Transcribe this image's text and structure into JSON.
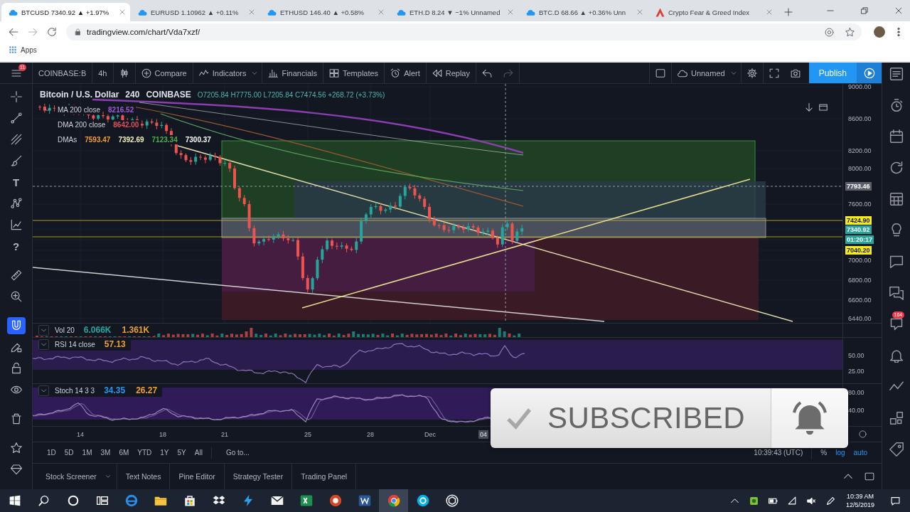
{
  "browser": {
    "tabs": [
      {
        "title": "BTCUSD 7340.92 ▲ +1.97%",
        "selected": true
      },
      {
        "title": "EURUSD 1.10962 ▲ +0.11%",
        "selected": false
      },
      {
        "title": "ETHUSD 146.40 ▲ +0.58%",
        "selected": false
      },
      {
        "title": "ETH.D 8.24 ▼ −1% Unnamed",
        "selected": false
      },
      {
        "title": "BTC.D 68.66 ▲ +0.36% Unn",
        "selected": false
      },
      {
        "title": "Crypto Fear & Greed Index",
        "selected": false
      }
    ],
    "address": "tradingview.com/chart/Vda7xzf/",
    "bookmarks": [
      "Apps"
    ]
  },
  "toolbar": {
    "menu_badge": "11",
    "symbol": "COINBASE:B",
    "interval": "4h",
    "buttons": [
      "Compare",
      "Indicators",
      "Financials",
      "Templates",
      "Alert",
      "Replay"
    ],
    "layout_name": "Unnamed",
    "publish": "Publish"
  },
  "legend": {
    "title": [
      "Bitcoin / U.S. Dollar",
      "240",
      "COINBASE"
    ],
    "values": "O7205.84 H7775.00 L7205.84 C7474.56 +268.72 (+3.73%)",
    "indicators": [
      {
        "name": "MA 200 close",
        "values": [
          {
            "text": "8216.52",
            "color": "#9c5bd6"
          }
        ]
      },
      {
        "name": "DMA 200 close",
        "values": [
          {
            "text": "8642.00",
            "color": "#e0505a"
          }
        ]
      },
      {
        "name": "DMAs",
        "values": [
          {
            "text": "7593.47",
            "color": "#f0a030"
          },
          {
            "text": "7392.69",
            "color": "#f2f0c0"
          },
          {
            "text": "7123.34",
            "color": "#4caf50"
          },
          {
            "text": "7300.37",
            "color": "#ffffff"
          }
        ]
      }
    ]
  },
  "price_axis": [
    {
      "text": "9000.00",
      "kind": "tick"
    },
    {
      "text": "8600.00",
      "kind": "tick"
    },
    {
      "text": "8200.00",
      "kind": "tick"
    },
    {
      "text": "8000.00",
      "kind": "tick"
    },
    {
      "text": "7793.46",
      "kind": "marker",
      "color": "#5d606b"
    },
    {
      "text": "7600.00",
      "kind": "tick"
    },
    {
      "text": "7424.90",
      "kind": "marker",
      "color": "#f5eb1a"
    },
    {
      "text": "7340.92",
      "kind": "marker",
      "color": "#26a69a"
    },
    {
      "text": "01:20:17",
      "kind": "marker",
      "color": "#26a69a"
    },
    {
      "text": "7040.20",
      "kind": "marker",
      "color": "#f5eb1a"
    },
    {
      "text": "7000.00",
      "kind": "tick"
    },
    {
      "text": "6800.00",
      "kind": "tick"
    },
    {
      "text": "6600.00",
      "kind": "tick"
    },
    {
      "text": "6440.00",
      "kind": "tick"
    }
  ],
  "panes": [
    {
      "kind": "volume",
      "name": "Vol 20",
      "values": [
        {
          "text": "6.066K",
          "color": "#26a69a"
        },
        {
          "text": "1.361K",
          "color": "#f0a030"
        }
      ]
    },
    {
      "kind": "rsi",
      "name": "RSI 14 close",
      "values": [
        {
          "text": "57.13",
          "color": "#f0a030"
        }
      ],
      "axis": [
        "50.00",
        "25.00"
      ]
    },
    {
      "kind": "stoch",
      "name": "Stoch 14 3 3",
      "values": [
        {
          "text": "34.35",
          "color": "#2196f3"
        },
        {
          "text": "26.27",
          "color": "#f0a030"
        }
      ],
      "axis": [
        "80.00",
        "40.00"
      ]
    }
  ],
  "time_axis": [
    {
      "text": "14",
      "kind": "tick"
    },
    {
      "text": "18",
      "kind": "tick"
    },
    {
      "text": "21",
      "kind": "tick"
    },
    {
      "text": "25",
      "kind": "tick"
    },
    {
      "text": "28",
      "kind": "tick"
    },
    {
      "text": "Dec",
      "kind": "tick"
    },
    {
      "text": "04",
      "kind": "cursor"
    }
  ],
  "range_bar": {
    "ranges": [
      "1D",
      "5D",
      "1M",
      "3M",
      "6M",
      "YTD",
      "1Y",
      "5Y",
      "All"
    ],
    "goto": "Go to...",
    "clock": "10:39:43 (UTC)",
    "scale_options": [
      {
        "label": "%",
        "selected": false
      },
      {
        "label": "log",
        "selected": true
      },
      {
        "label": "auto",
        "selected": true
      }
    ]
  },
  "drawing_tools": [
    {
      "selected": false
    },
    {
      "selected": false
    },
    {
      "selected": false
    },
    {
      "selected": false
    },
    {
      "glyph": "T",
      "selected": false
    },
    {
      "selected": false
    },
    {
      "selected": false
    },
    {
      "glyph": "?",
      "selected": false
    },
    {
      "selected": false
    },
    {
      "selected": false
    },
    {
      "selected": true
    },
    {
      "selected": false
    },
    {
      "selected": false
    },
    {
      "selected": false
    },
    {
      "selected": false
    },
    {
      "selected": false
    },
    {
      "selected": false
    }
  ],
  "side_panel": {
    "badge": "164"
  },
  "bottom_tabs": [
    "Stock Screener",
    "Text Notes",
    "Pine Editor",
    "Strategy Tester",
    "Trading Panel"
  ],
  "taskbar": {
    "apps": [
      {
        "selected": false
      },
      {
        "selected": false
      },
      {
        "selected": false
      },
      {
        "selected": false
      },
      {
        "selected": false
      },
      {
        "selected": false
      },
      {
        "selected": false
      },
      {
        "selected": false
      },
      {
        "selected": false
      },
      {
        "selected": true
      },
      {
        "selected": false
      },
      {
        "selected": false
      }
    ],
    "time": "10:39 AM",
    "date": "12/5/2019"
  },
  "overlay": {
    "label": "SUBSCRIBED"
  }
}
